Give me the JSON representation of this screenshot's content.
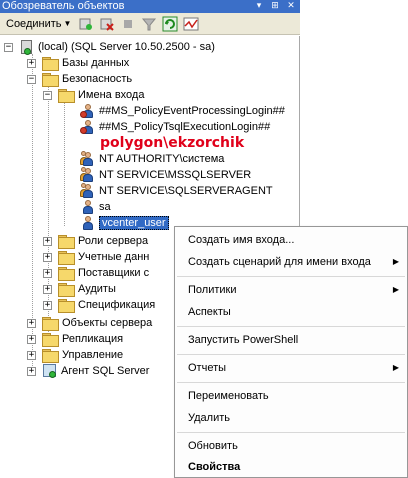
{
  "panel": {
    "title": "Обозреватель объектов"
  },
  "toolbar": {
    "connect_label": "Соединить"
  },
  "tree": {
    "server": "(local) (SQL Server 10.50.2500 - sa)",
    "databases": "Базы данных",
    "security": "Безопасность",
    "logins_folder": "Имена входа",
    "logins": [
      "##MS_PolicyEventProcessingLogin##",
      "##MS_PolicyTsqlExecutionLogin##",
      "NT AUTHORITY\\система",
      "NT SERVICE\\MSSQLSERVER",
      "NT SERVICE\\SQLSERVERAGENT",
      "sa",
      "vcenter_user"
    ],
    "server_roles": "Роли сервера",
    "credentials": "Учетные данн",
    "crypto_providers": "Поставщики с",
    "audits": "Аудиты",
    "specifications": "Спецификация",
    "server_objects": "Объекты сервера",
    "replication": "Репликация",
    "management": "Управление",
    "agent": "Агент SQL Server"
  },
  "annotation": "polygon\\ekzorchik",
  "context_menu": {
    "items": [
      "Создать имя входа...",
      "Создать сценарий для имени входа",
      "Политики",
      "Аспекты",
      "Запустить PowerShell",
      "Отчеты",
      "Переименовать",
      "Удалить",
      "Обновить",
      "Свойства"
    ]
  },
  "colors": {
    "titlebar": "#3b6fc8",
    "selection": "#316ac5",
    "annotation": "#e0001a"
  }
}
